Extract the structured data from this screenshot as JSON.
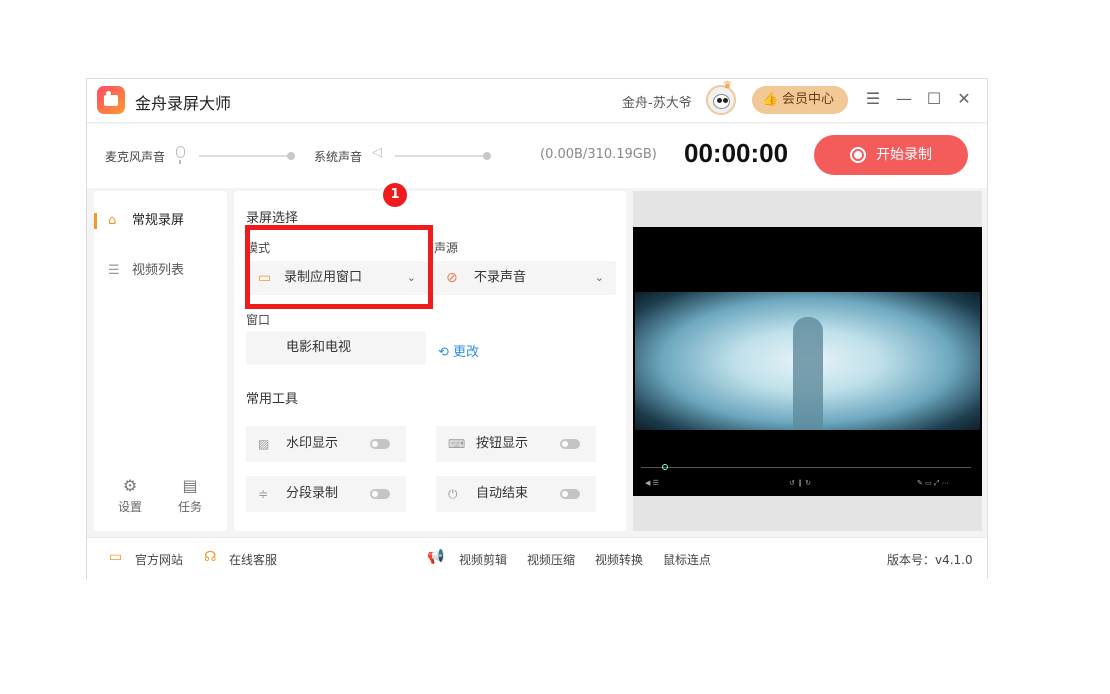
{
  "window": {
    "app_title": "金舟录屏大师",
    "username": "金舟-苏大爷",
    "vip_label": "会员中心",
    "controls": [
      "☰",
      "—",
      "☐",
      "✕"
    ]
  },
  "toolbar": {
    "mic_label": "麦克风声音",
    "system_label": "系统声音",
    "storage": "(0.00B/310.19GB)",
    "timer": "00:00:00",
    "record_label": "开始录制"
  },
  "sidebar": {
    "items": [
      {
        "label": "常规录屏",
        "icon": "camera-icon"
      },
      {
        "label": "视频列表",
        "icon": "list-icon"
      }
    ],
    "settings_label": "设置",
    "tasks_label": "任务"
  },
  "panel": {
    "section_record": "录屏选择",
    "mode_label": "模式",
    "mode_value": "录制应用窗口",
    "audio_label": "声源",
    "audio_value": "不录声音",
    "window_label": "窗口",
    "window_value": "电影和电视",
    "change_label": "更改",
    "section_tools": "常用工具",
    "tools": [
      {
        "label": "水印显示",
        "icon": "watermark-icon",
        "enabled": false
      },
      {
        "label": "按钮显示",
        "icon": "keyboard-icon",
        "enabled": false
      },
      {
        "label": "分段录制",
        "icon": "segment-icon",
        "enabled": false
      },
      {
        "label": "自动结束",
        "icon": "power-icon",
        "enabled": false
      }
    ],
    "badge": "1"
  },
  "footer": {
    "website": "官方网站",
    "support": "在线客服",
    "links": [
      "视频剪辑",
      "视频压缩",
      "视频转换",
      "鼠标连点"
    ],
    "version": "版本号：v4.1.0"
  },
  "colors": {
    "accent": "#f39a2b",
    "record": "#f45c5c",
    "highlight": "#ee1c1c",
    "link": "#2f8fe0"
  }
}
